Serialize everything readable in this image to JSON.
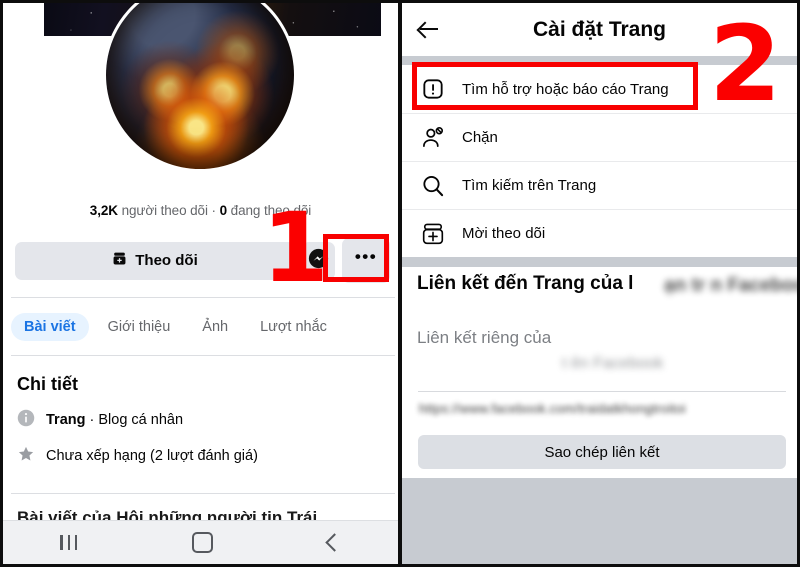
{
  "left_phone": {
    "profile": {
      "avatar_alt": "burning-earth-profile-photo",
      "cover_alt": "starfield-space-cover-photo",
      "stats": {
        "followers_count": "3,2K",
        "followers_label": "người theo dõi",
        "separator": "·",
        "following_count": "0",
        "following_label": "đang theo dõi"
      }
    },
    "actions": {
      "follow_label": "Theo dõi",
      "messenger_label": "Messenger",
      "more_label": "•••"
    },
    "tabs": [
      {
        "label": "Bài viết",
        "active": true
      },
      {
        "label": "Giới thiệu",
        "active": false
      },
      {
        "label": "Ảnh",
        "active": false
      },
      {
        "label": "Lượt nhắc",
        "active": false
      }
    ],
    "details": {
      "title": "Chi tiết",
      "rows": [
        {
          "icon": "info-icon",
          "bold": "Trang",
          "rest": " · Blog cá nhân"
        },
        {
          "icon": "star-icon",
          "bold": "",
          "rest": "Chưa xếp hạng (2 lượt đánh giá)"
        }
      ]
    },
    "feed_heading": "Bài viết của Hội những người tin Trái",
    "navbar": {
      "recents_label": "Recents",
      "home_label": "Home",
      "back_label": "Back"
    }
  },
  "right_phone": {
    "header": {
      "back_label": "Quay lại",
      "title": "Cài đặt Trang"
    },
    "menu": [
      {
        "icon": "exclamation-box-icon",
        "label": "Tìm hỗ trợ hoặc báo cáo Trang",
        "highlighted": true
      },
      {
        "icon": "block-user-icon",
        "label": "Chặn",
        "highlighted": false
      },
      {
        "icon": "search-icon",
        "label": "Tìm kiếm trên Trang",
        "highlighted": false
      },
      {
        "icon": "invite-follow-icon",
        "label": "Mời theo dõi",
        "highlighted": false
      }
    ],
    "link_section": {
      "title": "Liên kết đến Trang của l",
      "title_blur_tail": "ạn tr n Facebook",
      "subtitle": "Liên kết riêng của",
      "subtitle_blur_tail": "t ên Facebook",
      "url_blurred": "https://www.facebook.com/traidatkhongtroitoi",
      "copy_label": "Sao chép liên kết"
    }
  },
  "annotations": {
    "step1": "1",
    "step2": "2",
    "accent_color": "#fb0000"
  }
}
